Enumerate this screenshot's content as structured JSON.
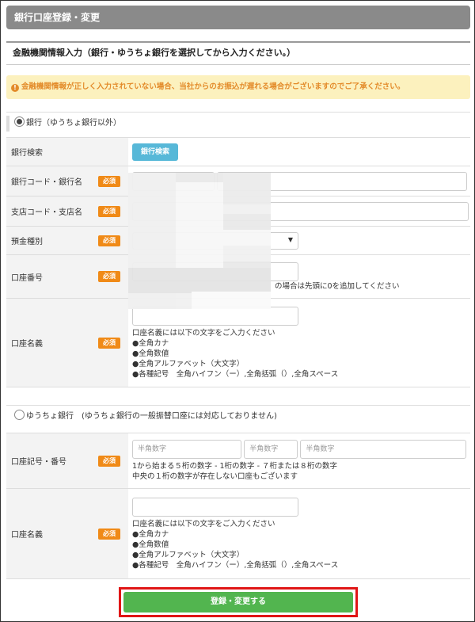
{
  "header": {
    "title": "銀行口座登録・変更"
  },
  "section": {
    "title": "金融機関情報入力（銀行・ゆうちょ銀行を選択してから入力ください。）"
  },
  "notice": {
    "icon": "exclamation-circle-icon",
    "text": "金融機関情報が正しく入力されていない場合、当社からのお振込が遅れる場合がございますのでご了承ください。",
    "color": "#e38b2a"
  },
  "required_label": "必須",
  "bank": {
    "radio_label": "銀行（ゆうちょ銀行以外）",
    "search_label": "銀行検索",
    "search_button": "銀行検索",
    "code_label": "銀行コード・銀行名",
    "branch_label": "支店コード・支店名",
    "type_label": "預金種別",
    "number_label": "口座番号",
    "number_note": "の場合は先頭に0を追加してください",
    "holder_label": "口座名義",
    "holder_notes": [
      "口座名義には以下の文字をご入力ください",
      "●全角カナ",
      "●全角数値",
      "●全角アルファベット（大文字）",
      "●各種記号　全角ハイフン（ー）,全角括弧（）,全角スペース"
    ]
  },
  "yucho": {
    "radio_label": "ゆうちょ銀行　(ゆうちょ銀行の一般振替口座には対応しておりません)",
    "number_label": "口座記号・番号",
    "placeholder_1": "半角数字",
    "placeholder_2": "半角数字",
    "placeholder_3": "半角数字",
    "number_notes": [
      "1から始まる５桁の数字 - 1桁の数字 - ７桁または８桁の数字",
      "中央の１桁の数字が存在しない口座もございます"
    ],
    "holder_label": "口座名義",
    "holder_notes": [
      "口座名義には以下の文字をご入力ください",
      "●全角カナ",
      "●全角数値",
      "●全角アルファベット（大文字）",
      "●各種記号　全角ハイフン（ー）,全角括弧（）,全角スペース"
    ]
  },
  "submit": {
    "label": "登録・変更する"
  }
}
